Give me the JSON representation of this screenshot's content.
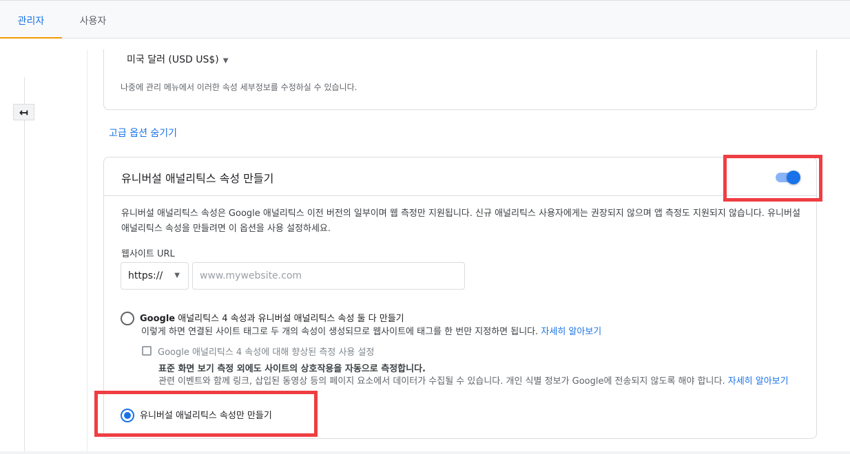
{
  "tabs": [
    {
      "label": "관리자",
      "active": true
    },
    {
      "label": "사용자",
      "active": false
    }
  ],
  "currency": {
    "value": "미국 달러 (USD US$)"
  },
  "card_note": "나중에 관리 메뉴에서 이러한 속성 세부정보를 수정하실 수 있습니다.",
  "advanced_link": "고급 옵션 숨기기",
  "ua_section": {
    "title": "유니버설 애널리틱스 속성 만들기",
    "toggle_on": true,
    "description": "유니버설 애널리틱스 속성은 Google 애널리틱스 이전 버전의 일부이며 웹 측정만 지원됩니다. 신규 애널리틱스 사용자에게는 권장되지 않으며 앱 측정도 지원되지 않습니다. 유니버설 애널리틱스 속성을 만들려면 이 옵션을 사용 설정하세요.",
    "url_label": "웹사이트 URL",
    "protocol": "https://",
    "url_placeholder": "www.mywebsite.com",
    "option_both": {
      "label_prefix": "Google",
      "label_main": " 애널리틱스 4 속성과 유니버설 애널리틱스 속성 둘 다 만들기",
      "description": "이렇게 하면 연결된 사이트 태그로 두 개의 속성이 생성되므로 웹사이트에 태그를 한 번만 지정하면 됩니다. ",
      "learn_more": "자세히 알아보기",
      "checked": false
    },
    "enhanced_measurement": {
      "checkbox_label": "Google 애널리틱스 4 속성에 대해 향상된 측정 사용 설정",
      "title": "표준 화면 보기 측정 외에도 사이트의 상호작용을 자동으로 측정합니다.",
      "description": "관련 이벤트와 함께 링크, 삽입된 동영상 등의 페이지 요소에서 데이터가 수집될 수 있습니다. 개인 식별 정보가 Google에 전송되지 않도록 해야 합니다. ",
      "learn_more": "자세히 알아보기"
    },
    "option_ua_only": {
      "label": "유니버설 애널리틱스 속성만 만들기",
      "checked": true
    }
  },
  "colors": {
    "accent": "#1a73e8",
    "highlight": "#ef3e42",
    "tab_indicator": "#f29900"
  }
}
